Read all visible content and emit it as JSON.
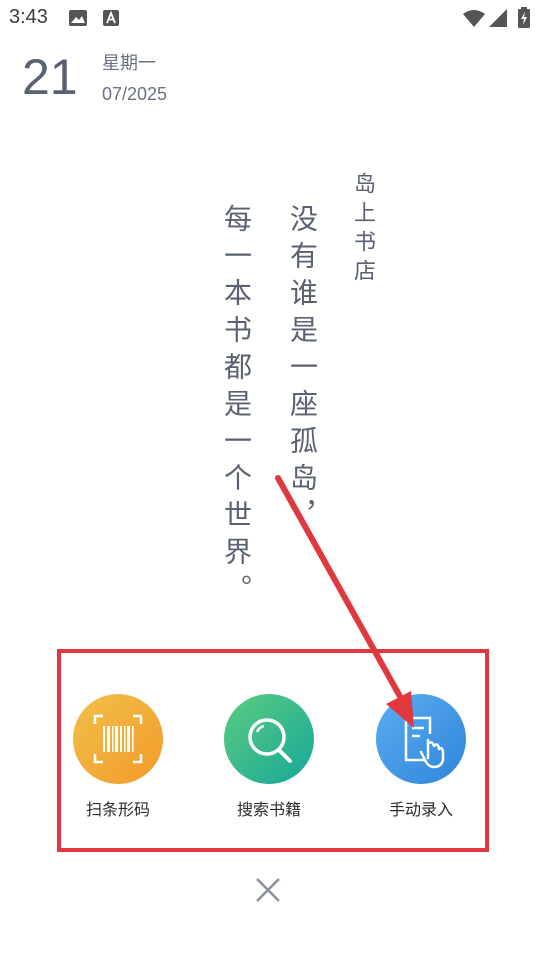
{
  "status_bar": {
    "time": "3:43",
    "icons": [
      "image-icon",
      "font-icon",
      "wifi-icon",
      "signal-icon",
      "battery-icon"
    ]
  },
  "date": {
    "day": "21",
    "weekday": "星期一",
    "month_year": "07/2025"
  },
  "quote": {
    "source": "岛上书店",
    "line1": "没有谁是一座孤岛，",
    "line2": "每一本书都是一个世界。"
  },
  "actions": [
    {
      "label": "扫条形码",
      "icon": "barcode-scan-icon",
      "color_start": "#f2c04a",
      "color_end": "#f39a2a"
    },
    {
      "label": "搜索书籍",
      "icon": "search-icon",
      "color_start": "#5ccc7e",
      "color_end": "#16a79a"
    },
    {
      "label": "手动录入",
      "icon": "manual-entry-icon",
      "color_start": "#5aaef2",
      "color_end": "#2f84d8"
    }
  ],
  "colors": {
    "highlight": "#e0383e",
    "text": "#5a6170"
  }
}
